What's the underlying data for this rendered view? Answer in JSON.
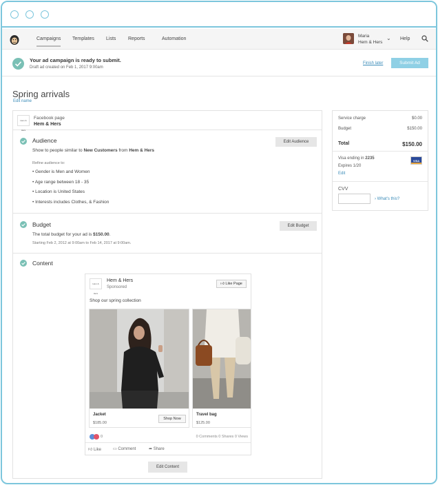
{
  "nav": {
    "items": [
      {
        "label": "Campaigns"
      },
      {
        "label": "Templates"
      },
      {
        "label": "Lists"
      },
      {
        "label": "Reports"
      },
      {
        "label": "Automation"
      }
    ],
    "user_name": "Maria",
    "user_org": "Hem & Hers",
    "help": "Help"
  },
  "notice": {
    "title": "Your ad campaign is ready to submit.",
    "subtitle": "Draft ad created on Feb 1, 2017 9:00am",
    "finish_later": "Finish later",
    "submit_label": "Submit Ad"
  },
  "page": {
    "title": "Spring arrivals",
    "edit_name": "Edit name"
  },
  "facebook": {
    "label": "Facebook page",
    "page_name": "Hem & Hers",
    "logo_text": "Hem & Hers"
  },
  "audience": {
    "title": "Audience",
    "desc_prefix": "Show to people similar to ",
    "desc_bold1": "New Customers",
    "desc_mid": " from ",
    "desc_bold2": "Hem & Hers",
    "refine_label": "Refine audience to:",
    "criteria": [
      "• Gender is Men and Women",
      "• Age range between 18 - 35",
      "• Location is United States",
      "• Interests includes Clothes, & Fashion"
    ],
    "edit_button": "Edit Audience"
  },
  "budget": {
    "title": "Budget",
    "desc_prefix": "The total budget for your ad is ",
    "desc_amount": "$150.00",
    "desc_suffix": ".",
    "dates": "Starting Feb 2, 2012 at 9:00am to Feb 14, 2017 at 9:00am.",
    "edit_button": "Edit Budget"
  },
  "content": {
    "title": "Content",
    "edit_button": "Edit Content",
    "ad": {
      "page_name": "Hem & Hers",
      "sponsored": "Sponsored",
      "like_page": "Like Page",
      "copy": "Shop our spring collection",
      "products": [
        {
          "name": "Jacket",
          "price": "$185.00",
          "cta": "Shop Now"
        },
        {
          "name": "Travel bag",
          "price": "$125.00"
        }
      ],
      "reaction_count": "0",
      "stats": "0 Comments  0 Shares  0 Views",
      "actions": [
        "Like",
        "Comment",
        "Share"
      ]
    }
  },
  "summary": {
    "service_charge_label": "Service charge",
    "service_charge_value": "$0.00",
    "budget_label": "Budget",
    "budget_value": "$150.00",
    "total_label": "Total",
    "total_value": "$150.00",
    "card_prefix": "Visa ending in ",
    "card_last4": "2235",
    "expires": "Expires 1/20",
    "edit": "Edit",
    "card_brand": "VISA",
    "cvv_label": "CVV",
    "whats_this": "What's this?"
  },
  "colors": {
    "frame": "#7cc6dc",
    "accent_teal": "#7ac0b5",
    "submit_button": "#8fd0e5",
    "link": "#3a8bb8"
  }
}
